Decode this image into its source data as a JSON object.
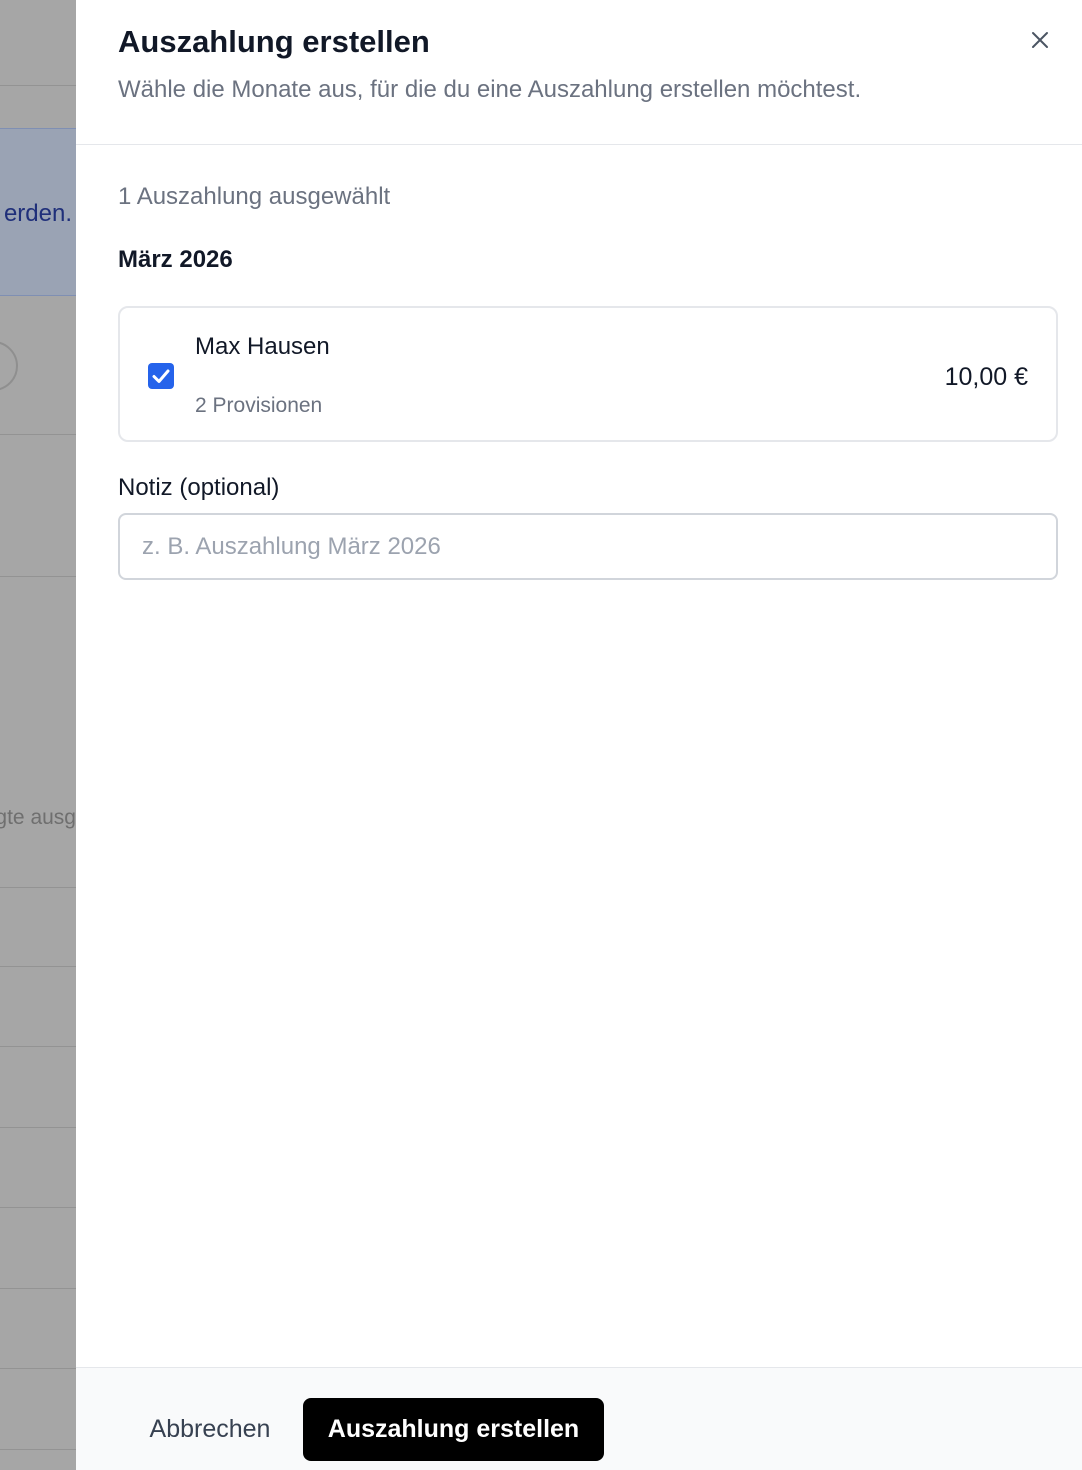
{
  "background": {
    "info_text_fragment": "erden.",
    "faded_text_fragment": "gte ausg"
  },
  "panel": {
    "title": "Auszahlung erstellen",
    "subtitle": "Wähle die Monate aus, für die du eine Auszahlung erstellen möchtest.",
    "close_icon": "close-icon",
    "selected_count": "1 Auszahlung ausgewählt",
    "month_heading": "März 2026",
    "payouts": [
      {
        "name": "Max Hausen",
        "commissions": "2 Provisionen",
        "amount": "10,00 €",
        "checked": true
      }
    ],
    "note": {
      "label": "Notiz (optional)",
      "value": "",
      "placeholder": "z. B. Auszahlung März 2026"
    },
    "footer": {
      "cancel_label": "Abbrechen",
      "submit_label": "Auszahlung erstellen"
    }
  },
  "colors": {
    "accent": "#2563eb",
    "primary_button": "#000000",
    "backdrop": "#a6a6a6"
  }
}
